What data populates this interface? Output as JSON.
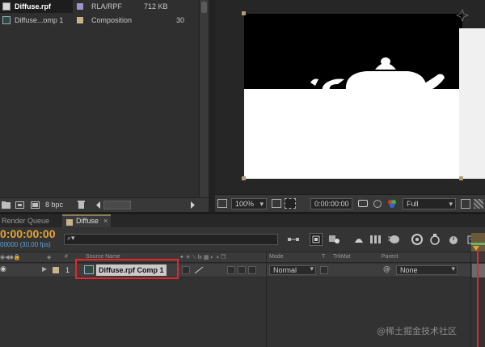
{
  "project": {
    "items": [
      {
        "name": "Diffuse.rpf",
        "type": "RLA/RPF",
        "size": "712 KB",
        "extra": "",
        "tag_color": "#9c95c8",
        "selected": true
      },
      {
        "name": "Diffuse...omp 1",
        "type": "Composition",
        "size": "",
        "extra": "30",
        "tag_color": "#c8b48a",
        "selected": false
      }
    ],
    "bpc": "8 bpc"
  },
  "viewer": {
    "zoom": "100%",
    "timecode": "0:00:00:00",
    "resolution": "Full"
  },
  "timeline": {
    "tabs": [
      {
        "label": "Render Queue",
        "active": false
      },
      {
        "label": "Diffuse",
        "active": true
      }
    ],
    "current_time": "0:00:00:00",
    "frame_info": "00000 (30.00 fps)",
    "search_placeholder": "",
    "columns": {
      "number": "#",
      "source_name": "Source Name",
      "mode": "Mode",
      "t": "T",
      "trkmat": "TrkMat",
      "parent": "Parent"
    },
    "layers": [
      {
        "number": "1",
        "name": "Diffuse.rpf Comp 1",
        "mode": "Normal",
        "parent": "None"
      }
    ]
  },
  "watermark": "@稀土掘金技术社区",
  "colors": {
    "highlight": "#e8252b",
    "time_orange": "#e6a531",
    "time_blue": "#5ba0d9"
  }
}
